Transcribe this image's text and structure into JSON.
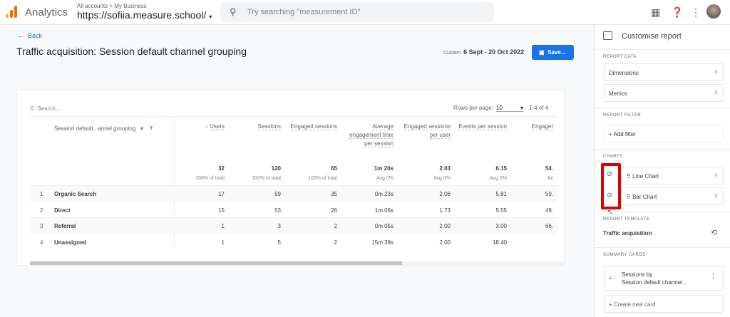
{
  "header": {
    "app_name": "Analytics",
    "breadcrumb": "All accounts > My Business",
    "property": "https://sofiia.measure.school/",
    "search_placeholder": "Try searching \"measurement ID\""
  },
  "page": {
    "back_label": "Back",
    "title": "Traffic acquisition: Session default channel grouping",
    "date_label": "Custom",
    "date_range": "6 Sept - 20 Oct 2022",
    "save_label": "Save..."
  },
  "table": {
    "search_placeholder": "Search...",
    "rows_per_page_label": "Rows per page:",
    "rows_per_page": "10",
    "pagination": "1-4 of 4",
    "dimension_header": "Session default...annel grouping",
    "columns": [
      {
        "label": "Users",
        "total": "32",
        "total_sub": "100% of total"
      },
      {
        "label": "Sessions",
        "total": "120",
        "total_sub": "100% of total"
      },
      {
        "label": "Engaged sessions",
        "total": "65",
        "total_sub": "100% of total"
      },
      {
        "label": "Average engagement time per session",
        "total": "1m 20s",
        "total_sub": "Avg 0%"
      },
      {
        "label": "Engaged sessions per user",
        "total": "2.03",
        "total_sub": "Avg 0%"
      },
      {
        "label": "Events per session",
        "total": "6.15",
        "total_sub": "Avg 0%"
      },
      {
        "label": "Engager",
        "total": "54.",
        "total_sub": "Av"
      }
    ],
    "rows": [
      {
        "n": "1",
        "name": "Organic Search",
        "values": [
          "17",
          "59",
          "35",
          "0m 23s",
          "2.06",
          "5.81",
          "59."
        ]
      },
      {
        "n": "2",
        "name": "Direct",
        "values": [
          "15",
          "53",
          "26",
          "1m 06s",
          "1.73",
          "5.55",
          "49."
        ]
      },
      {
        "n": "3",
        "name": "Referral",
        "values": [
          "1",
          "3",
          "2",
          "0m 05s",
          "2.00",
          "3.00",
          "66."
        ]
      },
      {
        "n": "4",
        "name": "Unassigned",
        "values": [
          "1",
          "5",
          "2",
          "15m 39s",
          "2.00",
          "18.40",
          ""
        ]
      }
    ]
  },
  "panel": {
    "title": "Customise report",
    "report_data_label": "REPORT DATA",
    "dimensions": "Dimensions",
    "metrics": "Metrics",
    "report_filter_label": "REPORT FILTER",
    "add_filter": "Add filter",
    "charts_label": "CHARTS",
    "charts": [
      "Line Chart",
      "Bar Chart"
    ],
    "report_template_label": "REPORT TEMPLATE",
    "template": "Traffic acquisition",
    "summary_cards_label": "SUMMARY CARDS",
    "card_line1": "Sessions by",
    "card_line2": "Session default channel...",
    "create_card": "Create new card"
  }
}
